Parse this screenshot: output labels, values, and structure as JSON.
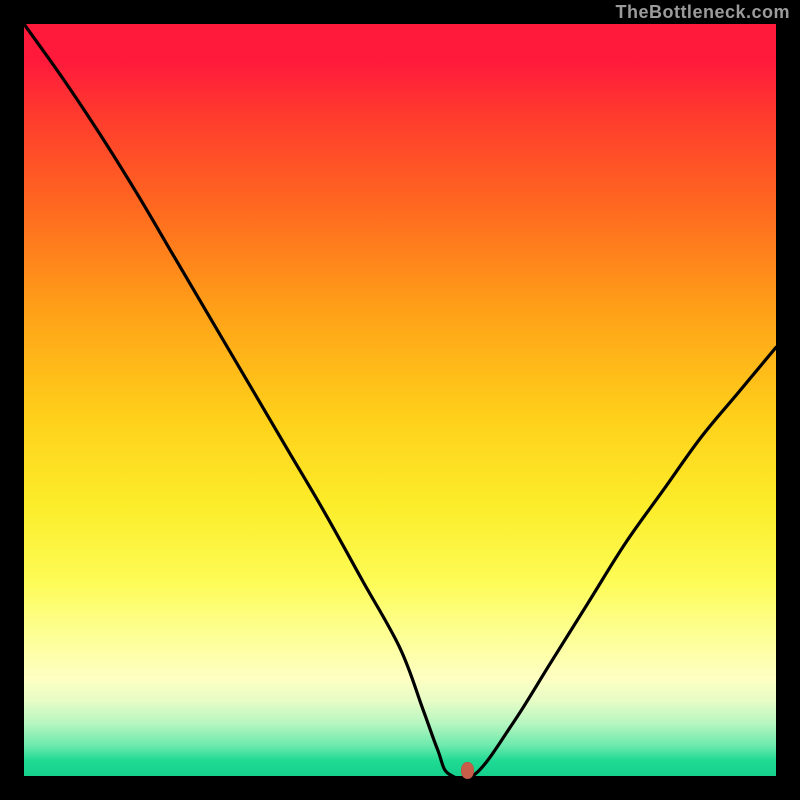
{
  "watermark": "TheBottleneck.com",
  "colors": {
    "background": "#000000",
    "gradient_top": "#ff1a3c",
    "gradient_bottom": "#14d08c",
    "curve": "#000000",
    "marker": "#c85d4a",
    "watermark": "#9b9b9b"
  },
  "chart_data": {
    "type": "line",
    "title": "",
    "xlabel": "",
    "ylabel": "",
    "xlim": [
      0,
      100
    ],
    "ylim": [
      0,
      100
    ],
    "x": [
      0,
      5,
      10,
      15,
      20,
      25,
      30,
      35,
      40,
      45,
      50,
      53,
      55,
      56.5,
      60,
      65,
      70,
      75,
      80,
      85,
      90,
      95,
      100
    ],
    "values": [
      100,
      93,
      85.5,
      77.5,
      69,
      60.5,
      52,
      43.5,
      35,
      26,
      17,
      9,
      3.5,
      0,
      0,
      7,
      15,
      23,
      31,
      38,
      45,
      51,
      57
    ],
    "plateau": {
      "x_start": 53,
      "x_end": 60,
      "y": 0
    },
    "marker": {
      "x": 59,
      "y": 0
    },
    "notes": "Y axis is inverted visually (0 at bottom = green = best). Values estimated from pixel positions relative to 752x752 plot area."
  }
}
